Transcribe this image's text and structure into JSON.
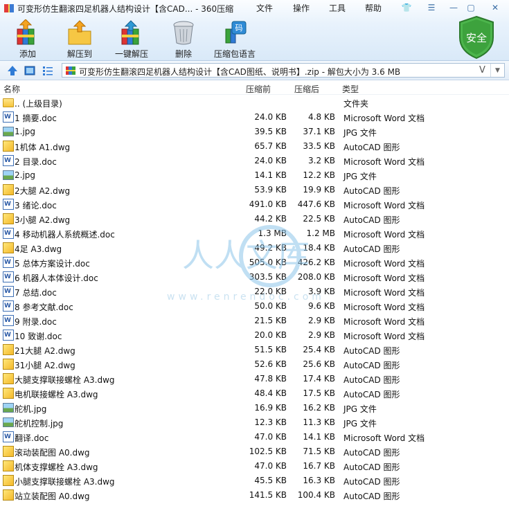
{
  "window": {
    "title": "可变形仿生翻滚四足机器人结构设计【含CAD... - 360压缩"
  },
  "menu": [
    {
      "label": "文件"
    },
    {
      "label": "操作"
    },
    {
      "label": "工具"
    },
    {
      "label": "帮助"
    }
  ],
  "toolbar": [
    {
      "label": "添加",
      "icon": "add-books-icon"
    },
    {
      "label": "解压到",
      "icon": "extract-to-folder-icon"
    },
    {
      "label": "一键解压",
      "icon": "one-click-extract-icon"
    },
    {
      "label": "删除",
      "icon": "trash-icon"
    },
    {
      "label": "压缩包语言",
      "icon": "archive-language-icon"
    }
  ],
  "toolbar_extra": {
    "badge": "码"
  },
  "security": {
    "label": "安全",
    "color": "#3aa33a"
  },
  "addressbar": {
    "path": "可变形仿生翻滚四足机器人结构设计【含CAD图纸、说明书】.zip - 解包大小为 3.6 MB",
    "v_mark": "V"
  },
  "columns": {
    "name": "名称",
    "size": "压缩前",
    "compressed": "压缩后",
    "type": "类型"
  },
  "files": [
    {
      "name": ".. (上级目录)",
      "size": "",
      "compressed": "",
      "type": "文件夹",
      "kind": "folder"
    },
    {
      "name": "1 摘要.doc",
      "size": "24.0 KB",
      "compressed": "4.8 KB",
      "type": "Microsoft Word 文档",
      "kind": "doc"
    },
    {
      "name": "1.jpg",
      "size": "39.5 KB",
      "compressed": "37.1 KB",
      "type": "JPG 文件",
      "kind": "jpg"
    },
    {
      "name": "1机体 A1.dwg",
      "size": "65.7 KB",
      "compressed": "33.5 KB",
      "type": "AutoCAD 图形",
      "kind": "dwg"
    },
    {
      "name": "2 目录.doc",
      "size": "24.0 KB",
      "compressed": "3.2 KB",
      "type": "Microsoft Word 文档",
      "kind": "doc"
    },
    {
      "name": "2.jpg",
      "size": "14.1 KB",
      "compressed": "12.2 KB",
      "type": "JPG 文件",
      "kind": "jpg"
    },
    {
      "name": "2大腿 A2.dwg",
      "size": "53.9 KB",
      "compressed": "19.9 KB",
      "type": "AutoCAD 图形",
      "kind": "dwg"
    },
    {
      "name": "3 绪论.doc",
      "size": "491.0 KB",
      "compressed": "447.6 KB",
      "type": "Microsoft Word 文档",
      "kind": "doc"
    },
    {
      "name": "3小腿 A2.dwg",
      "size": "44.2 KB",
      "compressed": "22.5 KB",
      "type": "AutoCAD 图形",
      "kind": "dwg"
    },
    {
      "name": "4 移动机器人系统概述.doc",
      "size": "1.3 MB",
      "compressed": "1.2 MB",
      "type": "Microsoft Word 文档",
      "kind": "doc"
    },
    {
      "name": "4足 A3.dwg",
      "size": "49.2 KB",
      "compressed": "18.4 KB",
      "type": "AutoCAD 图形",
      "kind": "dwg"
    },
    {
      "name": "5 总体方案设计.doc",
      "size": "505.0 KB",
      "compressed": "426.2 KB",
      "type": "Microsoft Word 文档",
      "kind": "doc"
    },
    {
      "name": "6 机器人本体设计.doc",
      "size": "303.5 KB",
      "compressed": "208.0 KB",
      "type": "Microsoft Word 文档",
      "kind": "doc"
    },
    {
      "name": "7 总结.doc",
      "size": "22.0 KB",
      "compressed": "3.9 KB",
      "type": "Microsoft Word 文档",
      "kind": "doc"
    },
    {
      "name": "8 参考文献.doc",
      "size": "50.0 KB",
      "compressed": "9.6 KB",
      "type": "Microsoft Word 文档",
      "kind": "doc"
    },
    {
      "name": "9 附录.doc",
      "size": "21.5 KB",
      "compressed": "2.9 KB",
      "type": "Microsoft Word 文档",
      "kind": "doc"
    },
    {
      "name": "10 致谢.doc",
      "size": "20.0 KB",
      "compressed": "2.9 KB",
      "type": "Microsoft Word 文档",
      "kind": "doc"
    },
    {
      "name": "21大腿 A2.dwg",
      "size": "51.5 KB",
      "compressed": "25.4 KB",
      "type": "AutoCAD 图形",
      "kind": "dwg"
    },
    {
      "name": "31小腿 A2.dwg",
      "size": "52.6 KB",
      "compressed": "25.6 KB",
      "type": "AutoCAD 图形",
      "kind": "dwg"
    },
    {
      "name": "大腿支撑联接螺栓 A3.dwg",
      "size": "47.8 KB",
      "compressed": "17.4 KB",
      "type": "AutoCAD 图形",
      "kind": "dwg"
    },
    {
      "name": "电机联接螺栓 A3.dwg",
      "size": "48.4 KB",
      "compressed": "17.5 KB",
      "type": "AutoCAD 图形",
      "kind": "dwg"
    },
    {
      "name": "舵机.jpg",
      "size": "16.9 KB",
      "compressed": "16.2 KB",
      "type": "JPG 文件",
      "kind": "jpg"
    },
    {
      "name": "舵机控制.jpg",
      "size": "12.3 KB",
      "compressed": "11.3 KB",
      "type": "JPG 文件",
      "kind": "jpg"
    },
    {
      "name": "翻译.doc",
      "size": "47.0 KB",
      "compressed": "14.1 KB",
      "type": "Microsoft Word 文档",
      "kind": "doc"
    },
    {
      "name": "滚动装配图 A0.dwg",
      "size": "102.5 KB",
      "compressed": "71.5 KB",
      "type": "AutoCAD 图形",
      "kind": "dwg"
    },
    {
      "name": "机体支撑螺栓 A3.dwg",
      "size": "47.0 KB",
      "compressed": "16.7 KB",
      "type": "AutoCAD 图形",
      "kind": "dwg"
    },
    {
      "name": "小腿支撑联接螺栓 A3.dwg",
      "size": "45.5 KB",
      "compressed": "16.3 KB",
      "type": "AutoCAD 图形",
      "kind": "dwg"
    },
    {
      "name": "站立装配图 A0.dwg",
      "size": "141.5 KB",
      "compressed": "100.4 KB",
      "type": "AutoCAD 图形",
      "kind": "dwg"
    }
  ],
  "watermark": {
    "text": "人人文库",
    "url": "www.renrendoc.com"
  }
}
